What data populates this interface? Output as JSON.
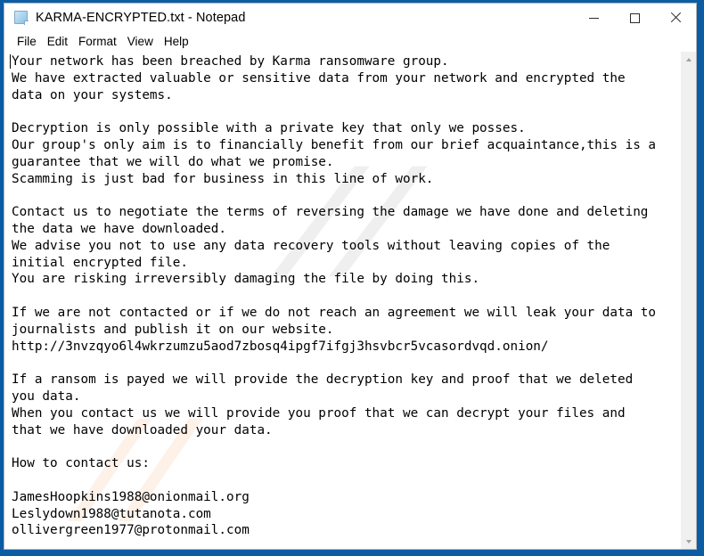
{
  "window": {
    "title": "KARMA-ENCRYPTED.txt - Notepad",
    "icon": "notepad-document-icon",
    "frame_color": "#0c5ca4",
    "controls": {
      "minimize": "—",
      "maximize": "□",
      "close": "✕"
    }
  },
  "menubar": {
    "items": [
      {
        "label": "File"
      },
      {
        "label": "Edit"
      },
      {
        "label": "Format"
      },
      {
        "label": "View"
      },
      {
        "label": "Help"
      }
    ]
  },
  "editor": {
    "content": "Your network has been breached by Karma ransomware group.\nWe have extracted valuable or sensitive data from your network and encrypted the\ndata on your systems.\n\nDecryption is only possible with a private key that only we posses.\nOur group's only aim is to financially benefit from our brief acquaintance,this is a\nguarantee that we will do what we promise.\nScamming is just bad for business in this line of work.\n\nContact us to negotiate the terms of reversing the damage we have done and deleting\nthe data we have downloaded.\nWe advise you not to use any data recovery tools without leaving copies of the\ninitial encrypted file.\nYou are risking irreversibly damaging the file by doing this.\n\nIf we are not contacted or if we do not reach an agreement we will leak your data to\njournalists and publish it on our website.\nhttp://3nvzqyo6l4wkrzumzu5aod7zbosq4ipgf7ifgj3hsvbcr5vcasordvqd.onion/\n\nIf a ransom is payed we will provide the decryption key and proof that we deleted\nyou data.\nWhen you contact us we will provide you proof that we can decrypt your files and\nthat we have downloaded your data.\n\nHow to contact us:\n\nJamesHoopkins1988@onionmail.org\nLeslydown1988@tutanota.com\nollivergreen1977@protonmail.com",
    "onion_url": "http://3nvzqyo6l4wkrzumzu5aod7zbosq4ipgf7ifgj3hsvbcr5vcasordvqd.onion/",
    "contact_emails": [
      "JamesHoopkins1988@onionmail.org",
      "Leslydown1988@tutanota.com",
      "ollivergreen1977@protonmail.com"
    ]
  },
  "watermarks": {
    "gray": "//",
    "peach": "//"
  },
  "scrollbar": {
    "up_arrow": "scroll-up-icon",
    "down_arrow": "scroll-down-icon"
  }
}
